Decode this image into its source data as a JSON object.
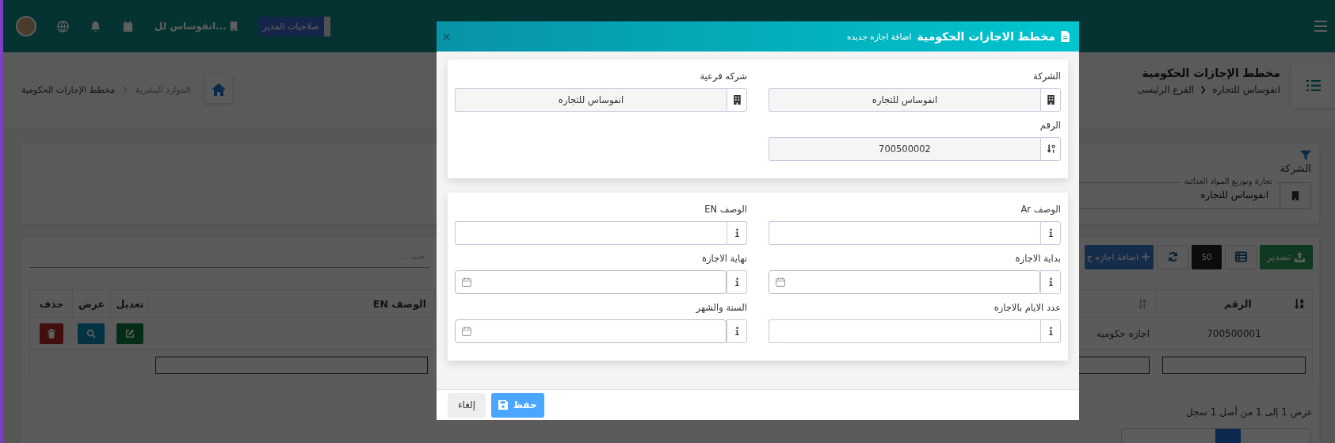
{
  "topbar": {
    "role": "صلاحيات المدير",
    "company": "انفوساس لل..."
  },
  "page_header": {
    "title": "مخطط الإجازات الحكومية",
    "path": [
      "انفوساس للتجاره",
      "الفرع الرئيسى"
    ]
  },
  "breadcrumb": [
    "الموارد البشرية",
    "مخطط الإجازات الحكومية"
  ],
  "filter": {
    "label": "الشركة",
    "legend": "تجارة وتوزيع المواد الغذائية",
    "value": "انفوساس للتجاره"
  },
  "toolbar": {
    "export": "تصدير",
    "page_size": "50",
    "add": "اضافة اجازه ج",
    "search_placeholder": "حث ..."
  },
  "table": {
    "columns": [
      {
        "label": "الرقم",
        "kind": "data",
        "sorted": true
      },
      {
        "kind": "data",
        "sorted": false
      },
      {
        "label": "الوصف EN",
        "kind": "data"
      },
      {
        "label": "تعديل",
        "kind": "edit"
      },
      {
        "label": "عرض",
        "kind": "view"
      },
      {
        "label": "حذف",
        "kind": "delete"
      }
    ],
    "rows": [
      {
        "cells": [
          "700500001",
          "اجازه حكوميه"
        ]
      }
    ]
  },
  "records_info": "عرض 1 إلى 1 من أصل 1 سجل",
  "modal": {
    "title": "مخطط الاجازات الحكومية",
    "subtitle": "اضافة اجازه جديده",
    "sections": [
      {
        "fields": [
          {
            "label": "الشركة",
            "value": "انفوساس للتجاره",
            "kind": "company"
          },
          {
            "label": "شركه فرعية",
            "value": "انفوساس للتجاره",
            "kind": "company"
          },
          {
            "label": "الرقم",
            "value": "700500002",
            "kind": "serial"
          }
        ]
      },
      {
        "fields": [
          {
            "label": "الوصف Ar",
            "kind": "text"
          },
          {
            "label": "الوصف EN",
            "kind": "text"
          },
          {
            "label": "بداية الاجازة",
            "kind": "date"
          },
          {
            "label": "نهاية الاجازة",
            "kind": "date"
          },
          {
            "label": "عدد الايام بالاجازه",
            "kind": "text"
          },
          {
            "label": "السنة والشهر",
            "kind": "date"
          }
        ]
      }
    ],
    "buttons": {
      "save": "حفظ",
      "cancel": "إلغاء"
    }
  }
}
